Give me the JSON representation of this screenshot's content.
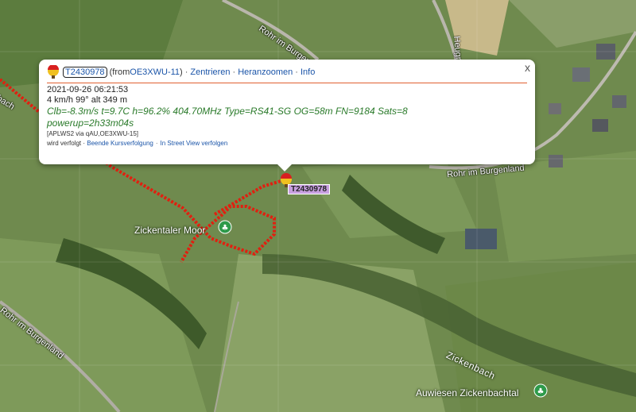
{
  "popup": {
    "callsign": "T2430978",
    "from_prefix": "(from ",
    "from_station": "OE3XWU-11",
    "from_suffix": ")",
    "sep": "·",
    "links": {
      "center": "Zentrieren",
      "zoom": "Heranzoomen",
      "info": "Info"
    },
    "timestamp": "2021-09-26 06:21:53",
    "speed_line": "4 km/h 99° alt 349 m",
    "telemetry_line1": "Clb=-8.3m/s t=9.7C h=96.2% 404.70MHz Type=RS41-SG OG=58m FN=9184 Sats=8",
    "telemetry_line2": "powerup=2h33m04s",
    "path": "[APLWS2 via qAU,OE3XWU-15]",
    "tracking_prefix": "wird verfolgt · ",
    "stop_tracking": "Beende Kursverfolgung",
    "street_view": "In Street View verfolgen",
    "close": "x"
  },
  "marker": {
    "label": "T2430978",
    "icon": "balloon-icon"
  },
  "map_labels": {
    "road_top": "Rohr im Burgenland",
    "road_right": "Rohr im Burgenland",
    "road_left": "Rohr im Burgenland",
    "road_heugraben": "Heugr...",
    "bach": "bach",
    "moor": "Zickentaler Moor",
    "creek": "Zickenbach",
    "auwiesen": "Auwiesen Zickenbachtal"
  },
  "colors": {
    "track": "#e02010",
    "link": "#1a54a8",
    "telemetry": "#2a7a2a"
  }
}
